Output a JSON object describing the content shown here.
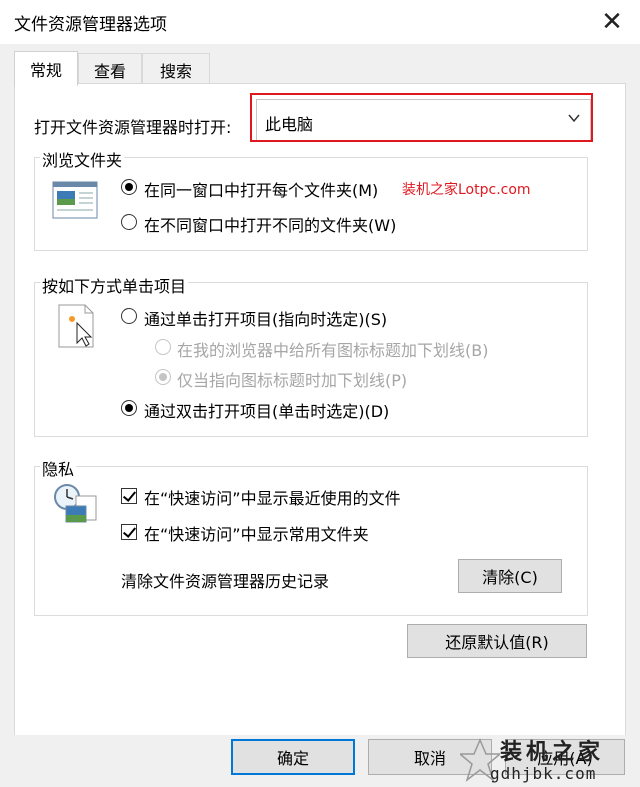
{
  "window": {
    "title": "文件资源管理器选项"
  },
  "tabs": [
    {
      "label": "常规",
      "active": true
    },
    {
      "label": "查看",
      "active": false
    },
    {
      "label": "搜索",
      "active": false
    }
  ],
  "open_explorer": {
    "label": "打开文件资源管理器时打开:",
    "value": "此电脑"
  },
  "browse_folders": {
    "legend": "浏览文件夹",
    "options": [
      {
        "label": "在同一窗口中打开每个文件夹(M)",
        "selected": true
      },
      {
        "label": "在不同窗口中打开不同的文件夹(W)",
        "selected": false
      }
    ]
  },
  "annotation": "装机之家Lotpc.com",
  "click_items": {
    "legend": "按如下方式单击项目",
    "options": [
      {
        "label": "通过单击打开项目(指向时选定)(S)",
        "selected": false
      },
      {
        "label": "在我的浏览器中给所有图标标题加下划线(B)",
        "selected": false,
        "disabled": true
      },
      {
        "label": "仅当指向图标标题时加下划线(P)",
        "selected": true,
        "disabled": true
      },
      {
        "label": "通过双击打开项目(单击时选定)(D)",
        "selected": true
      }
    ]
  },
  "privacy": {
    "legend": "隐私",
    "checks": [
      {
        "label": "在“快速访问”中显示最近使用的文件",
        "checked": true
      },
      {
        "label": "在“快速访问”中显示常用文件夹",
        "checked": true
      }
    ],
    "clear_label": "清除文件资源管理器历史记录",
    "clear_button": "清除(C)"
  },
  "restore_button": "还原默认值(R)",
  "footer": {
    "ok": "确定",
    "cancel": "取消",
    "apply": "应用(A)"
  },
  "watermark": {
    "line1": "装机之家",
    "line2": "gdhjbk.com"
  },
  "colors": {
    "highlight": "#e0191f",
    "accent": "#0078d7"
  }
}
